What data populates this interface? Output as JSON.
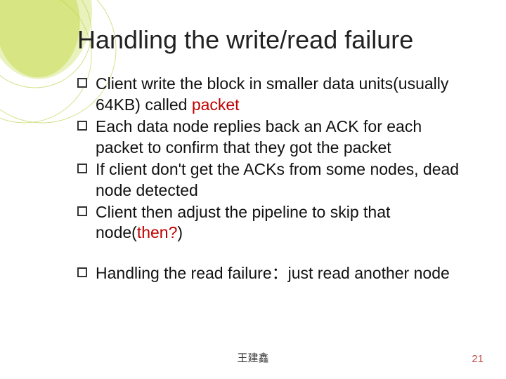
{
  "title": "Handling the write/read failure",
  "bullets": [
    {
      "pre": "Client write the block in smaller data units(usually 64KB) called ",
      "em": "packet",
      "post": ""
    },
    {
      "pre": "Each data node replies back an ACK for each packet to confirm that they got the packet",
      "em": "",
      "post": ""
    },
    {
      "pre": "If client don't get the ACKs from some nodes, dead node detected",
      "em": "",
      "post": ""
    },
    {
      "pre": "Client then adjust the pipeline to skip that node(",
      "em": "then?",
      "post": ")"
    },
    {
      "pre": "Handling the read failure：just read another node",
      "em": "",
      "post": "",
      "gap": true
    }
  ],
  "footer": {
    "author": "王建鑫",
    "page": "21"
  }
}
